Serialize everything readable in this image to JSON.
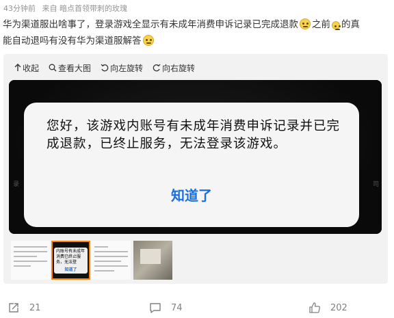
{
  "post": {
    "time": "43分钟前",
    "source": "来自 暗点首领带刺的玫瑰",
    "text_line1a": "华为渠道服出啥事了，登录游戏全显示有未成年消费申诉记录已完成退款",
    "text_line1b": "之前",
    "text_line1c": "的真",
    "text_line2": "能自动退吗有没有华为渠道服解答"
  },
  "toolbar": {
    "collapse": "收起",
    "view_large": "查看大图",
    "rotate_left": "向左旋转",
    "rotate_right": "向右旋转"
  },
  "image": {
    "dialog_message": "您好，该游戏内账号有未成年消费申诉记录并已完成退款，已终止服务，无法登录该游戏。",
    "dialog_button": "知道了",
    "side_left": "录",
    "side_right": "司"
  },
  "thumbnails": {
    "selected_index": 1,
    "thumb2_text": "内账号有未成年消费已终止服务，无法登",
    "thumb2_button": "知道了"
  },
  "footer": {
    "reposts": "21",
    "comments": "74",
    "likes": "202"
  },
  "colors": {
    "accent_orange": "#ff8200",
    "dialog_blue": "#1a6fe0"
  }
}
